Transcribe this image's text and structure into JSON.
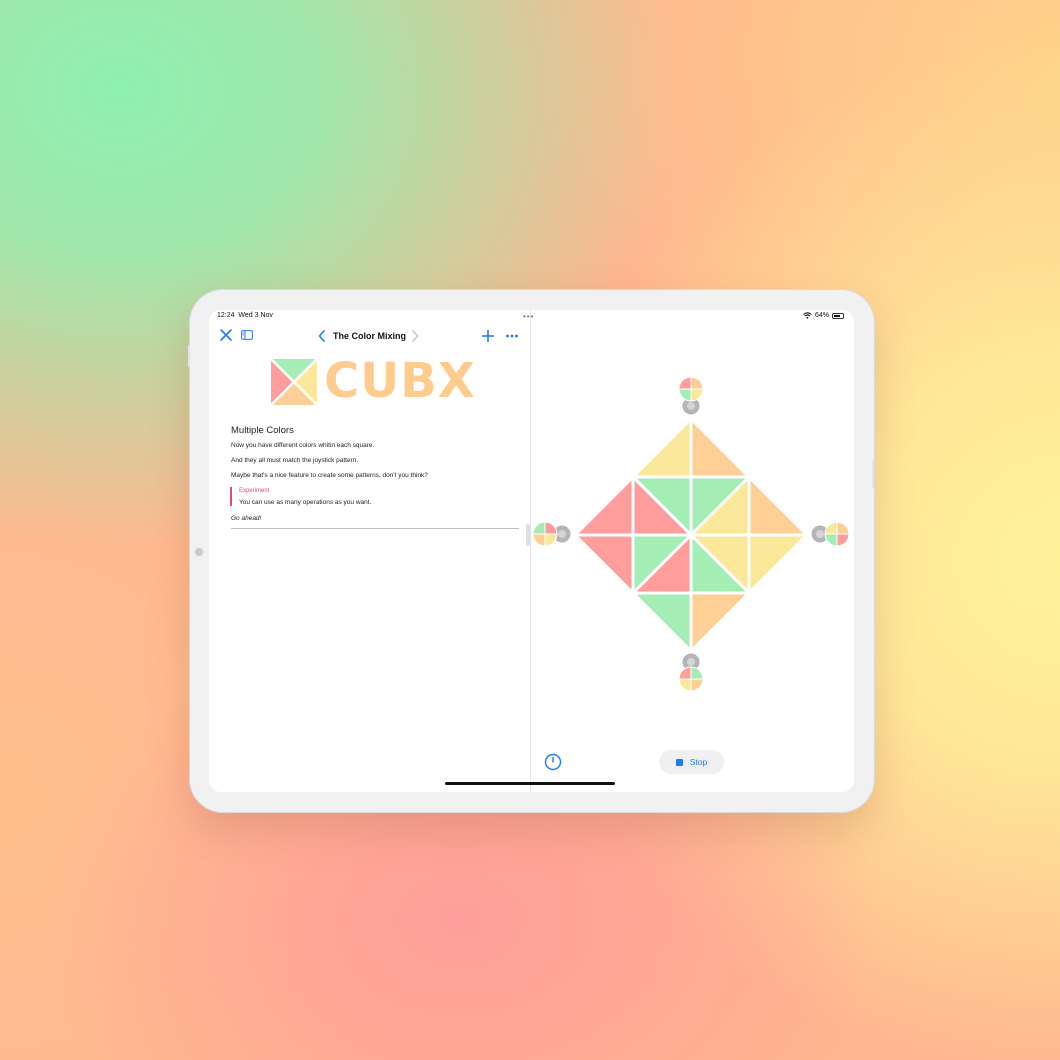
{
  "status_bar": {
    "time": "12:24",
    "date": "Wed 3 Nov",
    "battery": "64%",
    "wifi_icon": "wifi-icon",
    "battery_icon": "battery-icon"
  },
  "multitask_handle": "•••",
  "nav": {
    "title": "The Color Mixing",
    "close_icon": "close-icon",
    "sidebar_icon": "sidebar-icon",
    "back_icon": "chevron-left-icon",
    "forward_icon": "chevron-right-icon",
    "add_icon": "plus-icon",
    "more_icon": "ellipsis-icon"
  },
  "logo": {
    "text": "CUBX",
    "colors": [
      "#a4eeb6",
      "#ff9c9c",
      "#fbe79a",
      "#ffcf96"
    ]
  },
  "doc": {
    "heading": "Multiple Colors",
    "paragraphs": [
      "Now you have different colors whitin each square.",
      "And they all must match the joystick pattern.",
      "Maybe that's a nice feature to create some patterns, don't you think?"
    ],
    "callout": {
      "title": "Experiment",
      "text": "You can use as many operations as you want.",
      "accent_color": "#e0468c"
    },
    "closing": "Go ahead!"
  },
  "puzzle": {
    "tile_colors": {
      "red": "#ff9c9c",
      "green": "#a4eeb6",
      "yellow": "#fbe79a",
      "orange": "#ffcf96"
    },
    "joystick_color": "#b5b5b5"
  },
  "controls": {
    "timer_icon": "timer-icon",
    "stop_icon": "stop-icon",
    "stop_label": "Stop",
    "accent": "#1a7bf5"
  }
}
